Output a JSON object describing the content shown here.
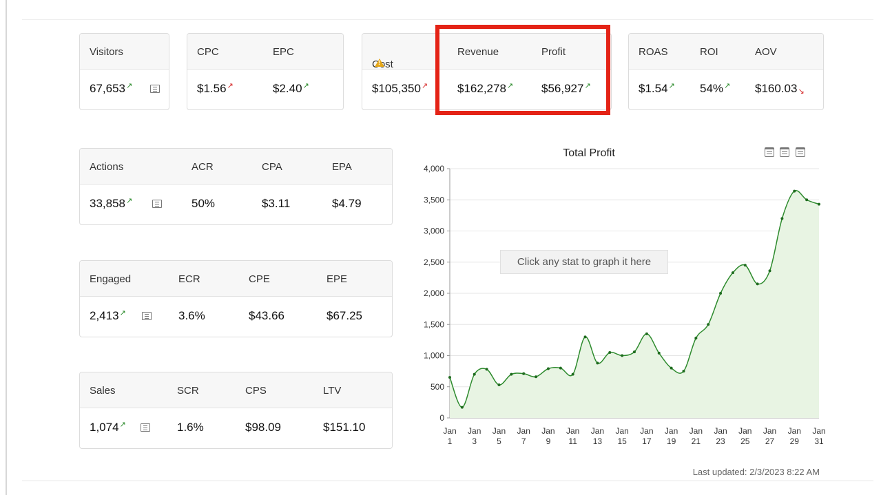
{
  "top_cards": [
    {
      "id": "visitors",
      "columns": [
        {
          "label": "Visitors",
          "value": "67,653",
          "arrow": "up",
          "color": ""
        }
      ],
      "has_list_icon": true
    },
    {
      "id": "cpc-epc",
      "columns": [
        {
          "label": "CPC",
          "value": "$1.56",
          "arrow": "upred",
          "color": ""
        },
        {
          "label": "EPC",
          "value": "$2.40",
          "arrow": "up",
          "color": ""
        }
      ]
    },
    {
      "id": "cost-rev-profit",
      "columns": [
        {
          "label": "Cost",
          "value": "$105,350",
          "arrow": "upred",
          "color": ""
        },
        {
          "label": "Revenue",
          "value": "$162,278",
          "arrow": "up",
          "color": ""
        },
        {
          "label": "Profit",
          "value": "$56,927",
          "arrow": "up",
          "color": "green"
        }
      ]
    },
    {
      "id": "roas-roi-aov",
      "columns": [
        {
          "label": "ROAS",
          "value": "$1.54",
          "arrow": "up",
          "color": "green"
        },
        {
          "label": "ROI",
          "value": "54%",
          "arrow": "up",
          "color": "green"
        },
        {
          "label": "AOV",
          "value": "$160.03",
          "arrow": "down",
          "color": ""
        }
      ]
    }
  ],
  "side_cards": [
    {
      "id": "actions",
      "columns": [
        {
          "label": "Actions",
          "value": "33,858",
          "arrow": "up"
        },
        {
          "label": "ACR",
          "value": "50%"
        },
        {
          "label": "CPA",
          "value": "$3.11"
        },
        {
          "label": "EPA",
          "value": "$4.79"
        }
      ]
    },
    {
      "id": "engaged",
      "columns": [
        {
          "label": "Engaged",
          "value": "2,413",
          "arrow": "up"
        },
        {
          "label": "ECR",
          "value": "3.6%"
        },
        {
          "label": "CPE",
          "value": "$43.66"
        },
        {
          "label": "EPE",
          "value": "$67.25"
        }
      ]
    },
    {
      "id": "sales",
      "columns": [
        {
          "label": "Sales",
          "value": "1,074",
          "arrow": "up"
        },
        {
          "label": "SCR",
          "value": "1.6%"
        },
        {
          "label": "CPS",
          "value": "$98.09"
        },
        {
          "label": "LTV",
          "value": "$151.10"
        }
      ]
    }
  ],
  "chart": {
    "title": "Total Profit",
    "hint": "Click any stat to graph it here",
    "updated": "Last updated: 2/3/2023 8:22 AM"
  },
  "colors": {
    "up_arrow": "#2a8a2a",
    "down_arrow": "#d62a2a",
    "line": "#2e8b2e",
    "area": "#e8f4e3",
    "highlight": "#e42316",
    "warning": "#e6a81a"
  },
  "chart_data": {
    "type": "area",
    "title": "Total Profit",
    "xlabel": "",
    "ylabel": "",
    "x_ticks": [
      "Jan 1",
      "Jan 3",
      "Jan 5",
      "Jan 7",
      "Jan 9",
      "Jan 11",
      "Jan 13",
      "Jan 15",
      "Jan 17",
      "Jan 19",
      "Jan 21",
      "Jan 23",
      "Jan 25",
      "Jan 27",
      "Jan 29",
      "Jan 31"
    ],
    "y_ticks": [
      0,
      500,
      1000,
      1500,
      2000,
      2500,
      3000,
      3500,
      4000
    ],
    "ylim": [
      0,
      4000
    ],
    "xlim": [
      1,
      31
    ],
    "grid": true,
    "x": [
      1,
      2,
      3,
      4,
      5,
      6,
      7,
      8,
      9,
      10,
      11,
      12,
      13,
      14,
      15,
      16,
      17,
      18,
      19,
      20,
      21,
      22,
      23,
      24,
      25,
      26,
      27,
      28,
      29,
      30,
      31
    ],
    "values": [
      650,
      170,
      700,
      780,
      530,
      700,
      710,
      660,
      790,
      800,
      700,
      1300,
      880,
      1050,
      1000,
      1060,
      1350,
      1040,
      800,
      750,
      1280,
      1500,
      2000,
      2330,
      2450,
      2150,
      2360,
      3200,
      3640,
      3500,
      3430
    ]
  }
}
